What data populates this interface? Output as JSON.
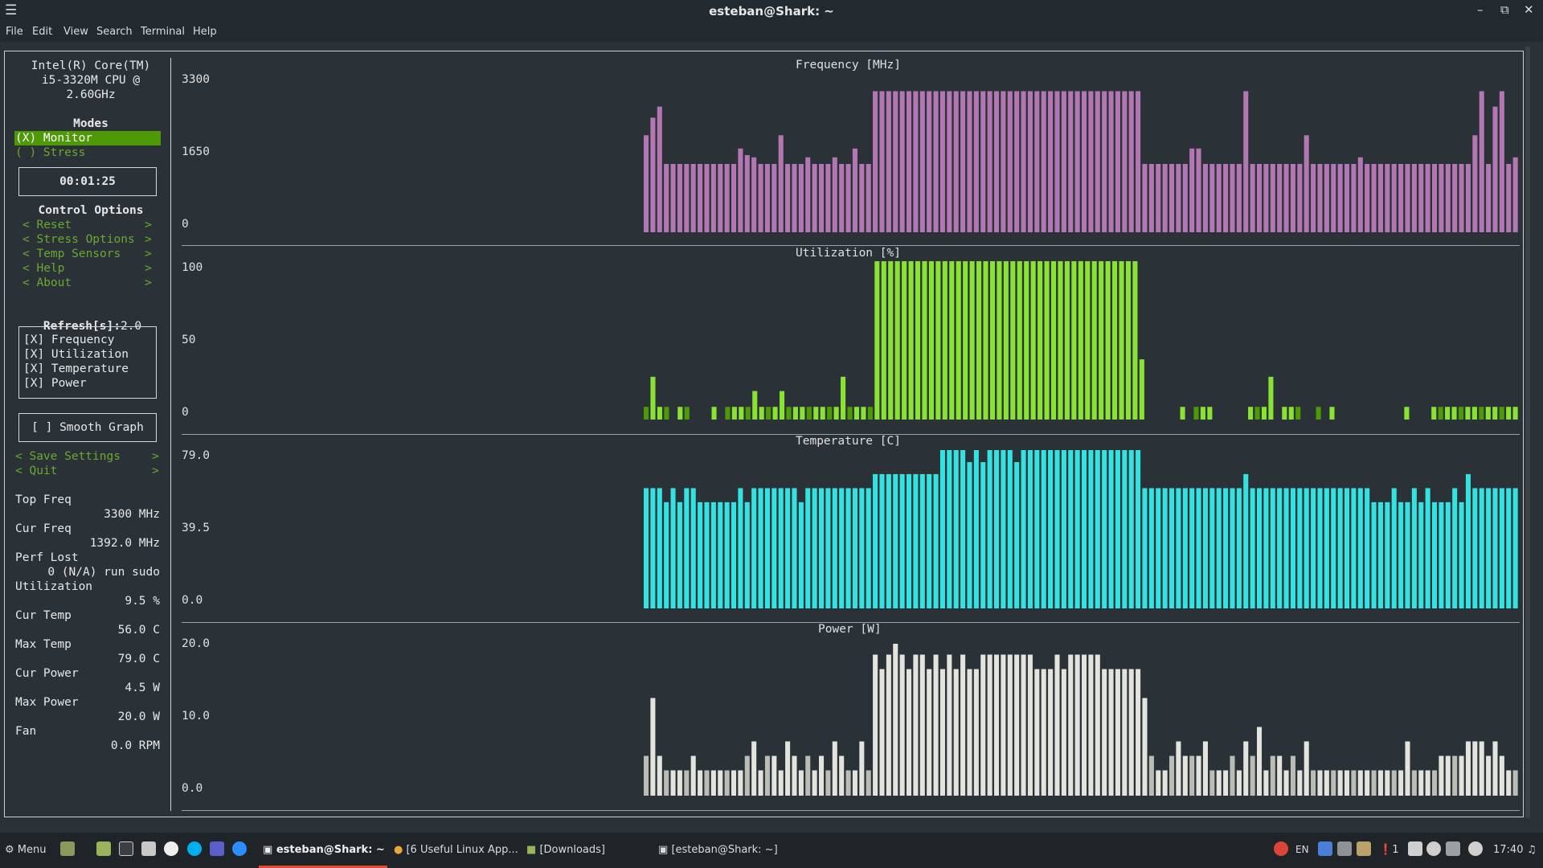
{
  "window": {
    "title": "esteban@Shark: ~",
    "menu": [
      "File",
      "Edit",
      "View",
      "Search",
      "Terminal",
      "Help"
    ],
    "minimize_glyph": "–",
    "maximize_glyph": "⧉",
    "close_glyph": "✕",
    "menu_glyph": "☰"
  },
  "sidebar": {
    "cpu_line1": "Intel(R) Core(TM)",
    "cpu_line2": "i5-3320M CPU @",
    "cpu_line3": "2.60GHz",
    "modes_title": "Modes",
    "mode_monitor": "(X) Monitor",
    "mode_stress": "( ) Stress",
    "timer": "00:01:25",
    "control_title": "Control Options",
    "controls": [
      {
        "label": "< Reset",
        "end": ">"
      },
      {
        "label": "< Stress Options",
        "end": ">"
      },
      {
        "label": "< Temp Sensors",
        "end": ">"
      },
      {
        "label": "< Help",
        "end": ">"
      },
      {
        "label": "< About",
        "end": ">"
      }
    ],
    "refresh_label": "Refresh[s]:",
    "refresh_value": "2.0",
    "checkboxes": [
      "[X] Frequency",
      "[X] Utilization",
      "[X] Temperature",
      "[X] Power"
    ],
    "smooth": "[ ] Smooth Graph",
    "save": "< Save Settings",
    "quit": "< Quit",
    "arrow": ">",
    "stats": [
      {
        "label": "Top Freq",
        "value": "3300 MHz"
      },
      {
        "label": "Cur Freq",
        "value": "1392.0 MHz"
      },
      {
        "label": "Perf Lost",
        "value": "0 (N/A) run sudo"
      },
      {
        "label": "Utilization",
        "value": "9.5 %"
      },
      {
        "label": "Cur Temp",
        "value": "56.0 C"
      },
      {
        "label": "Max Temp",
        "value": "79.0 C"
      },
      {
        "label": "Cur Power",
        "value": "4.5 W"
      },
      {
        "label": "Max Power",
        "value": "20.0 W"
      },
      {
        "label": "Fan",
        "value": "0.0 RPM"
      }
    ]
  },
  "graphs": [
    {
      "title": "Frequency [MHz]",
      "ticks": [
        "3300",
        "1650",
        "0"
      ],
      "max": 3300,
      "color": "#b378b3",
      "color_dark": "#7e4f86",
      "values": [
        2200,
        2600,
        2850,
        1550,
        1550,
        1550,
        1550,
        1550,
        1550,
        1550,
        1550,
        1550,
        1550,
        1550,
        1900,
        1750,
        1700,
        1550,
        1550,
        1550,
        2200,
        1550,
        1550,
        1550,
        1700,
        1550,
        1550,
        1550,
        1700,
        1550,
        1550,
        1900,
        1550,
        1550,
        3200,
        3200,
        3200,
        3200,
        3200,
        3200,
        3200,
        3200,
        3200,
        3200,
        3200,
        3200,
        3200,
        3200,
        3200,
        3200,
        3200,
        3200,
        3200,
        3200,
        3200,
        3200,
        3200,
        3200,
        3200,
        3200,
        3200,
        3200,
        3200,
        3200,
        3200,
        3200,
        3200,
        3200,
        3200,
        3200,
        3200,
        3200,
        3200,
        3200,
        1550,
        1550,
        1550,
        1550,
        1550,
        1550,
        1550,
        1900,
        1900,
        1550,
        1550,
        1550,
        1550,
        1550,
        1550,
        3200,
        1550,
        1550,
        1550,
        1550,
        1550,
        1550,
        1550,
        1550,
        2200,
        1550,
        1550,
        1550,
        1550,
        1550,
        1550,
        1550,
        1700,
        1550,
        1550,
        1550,
        1550,
        1550,
        1550,
        1550,
        1550,
        1550,
        1550,
        1550,
        1550,
        1550,
        1550,
        1550,
        1550,
        2200,
        3200,
        1550,
        2850,
        3200,
        1550,
        1700
      ]
    },
    {
      "title": "Utilization [%]",
      "ticks": [
        "100",
        "50",
        "0"
      ],
      "max": 100,
      "color": "#8ae234",
      "color_dark": "#4e9a06",
      "values": [
        8,
        27,
        8,
        8,
        0,
        8,
        8,
        0,
        0,
        0,
        8,
        0,
        8,
        8,
        8,
        8,
        18,
        8,
        8,
        8,
        18,
        8,
        8,
        8,
        8,
        8,
        8,
        8,
        8,
        27,
        8,
        8,
        8,
        8,
        100,
        100,
        100,
        100,
        100,
        100,
        100,
        100,
        100,
        100,
        100,
        100,
        100,
        100,
        100,
        100,
        100,
        100,
        100,
        100,
        100,
        100,
        100,
        100,
        100,
        100,
        100,
        100,
        100,
        100,
        100,
        100,
        100,
        100,
        100,
        100,
        100,
        100,
        100,
        38,
        0,
        0,
        0,
        0,
        0,
        8,
        0,
        8,
        8,
        8,
        0,
        0,
        0,
        0,
        0,
        8,
        8,
        8,
        27,
        0,
        8,
        8,
        8,
        0,
        0,
        8,
        0,
        8,
        0,
        0,
        0,
        0,
        0,
        0,
        0,
        0,
        0,
        0,
        8,
        0,
        0,
        0,
        8,
        8,
        8,
        8,
        8,
        8,
        8,
        8,
        8,
        8,
        8,
        8,
        8
      ]
    },
    {
      "title": "Temperature [C]",
      "ticks": [
        "79.0",
        "39.5",
        "0.0"
      ],
      "max": 79,
      "color": "#34e2e2",
      "color_dark": "#06989a",
      "values": [
        60,
        60,
        60,
        53,
        60,
        53,
        60,
        60,
        53,
        53,
        53,
        53,
        53,
        53,
        60,
        53,
        60,
        60,
        60,
        60,
        60,
        60,
        60,
        53,
        60,
        60,
        60,
        60,
        60,
        60,
        60,
        60,
        60,
        60,
        67,
        67,
        67,
        67,
        67,
        67,
        67,
        67,
        67,
        67,
        79,
        79,
        79,
        79,
        73,
        79,
        73,
        79,
        79,
        79,
        79,
        73,
        79,
        79,
        79,
        79,
        79,
        79,
        79,
        79,
        79,
        79,
        79,
        79,
        79,
        79,
        79,
        79,
        79,
        79,
        60,
        60,
        60,
        60,
        60,
        60,
        60,
        60,
        60,
        60,
        60,
        60,
        60,
        60,
        60,
        67,
        60,
        60,
        60,
        60,
        60,
        60,
        60,
        60,
        60,
        60,
        60,
        60,
        60,
        60,
        60,
        60,
        60,
        60,
        53,
        53,
        53,
        60,
        53,
        53,
        60,
        53,
        60,
        53,
        53,
        53,
        60,
        53,
        67,
        60,
        60,
        60,
        60,
        60,
        60,
        60
      ]
    },
    {
      "title": "Power [W]",
      "ticks": [
        "20.0",
        "10.0",
        "0.0"
      ],
      "max": 20,
      "color": "#e4e4df",
      "color_dark": "#babdb6",
      "values": [
        5.5,
        13.5,
        5.5,
        3.5,
        3.5,
        3.5,
        3.5,
        5.5,
        3.5,
        3.5,
        3.5,
        3.5,
        3.5,
        3.5,
        3.5,
        5.5,
        7.5,
        3.5,
        5.5,
        5.5,
        3.5,
        7.5,
        5.5,
        3.5,
        5.5,
        3.5,
        5.5,
        3.5,
        7.5,
        5.5,
        3.5,
        3.5,
        7.5,
        3.5,
        19.5,
        17.5,
        19.5,
        21.0,
        19.5,
        17.5,
        19.5,
        19.5,
        17.5,
        19.5,
        17.5,
        19.5,
        17.5,
        19.5,
        17.5,
        17.5,
        19.5,
        19.5,
        19.5,
        19.5,
        19.5,
        19.5,
        19.5,
        19.5,
        17.5,
        17.5,
        17.5,
        19.5,
        17.5,
        19.5,
        19.5,
        19.5,
        19.5,
        19.5,
        17.5,
        17.5,
        17.5,
        17.5,
        17.5,
        17.5,
        13.5,
        5.5,
        3.5,
        3.5,
        5.5,
        7.5,
        5.5,
        5.5,
        5.5,
        7.5,
        3.5,
        3.5,
        3.5,
        5.5,
        3.5,
        7.5,
        5.5,
        9.5,
        3.5,
        5.5,
        5.5,
        3.5,
        5.5,
        3.5,
        7.5,
        3.5,
        3.5,
        3.5,
        3.5,
        3.5,
        3.5,
        3.5,
        3.5,
        3.5,
        3.5,
        3.5,
        3.5,
        3.5,
        3.5,
        7.5,
        3.5,
        3.5,
        3.5,
        3.5,
        5.5,
        5.5,
        5.5,
        5.5,
        7.5,
        7.5,
        7.5,
        5.5,
        7.5,
        5.5,
        3.5,
        3.5
      ]
    }
  ],
  "taskbar": {
    "menu_label": "Menu",
    "tasks": [
      "esteban@Shark: ~",
      "[6 Useful Linux App...",
      "[Downloads]",
      "[esteban@Shark: ~]"
    ],
    "lang": "EN",
    "notif_count": "1",
    "clock": "17:40"
  }
}
